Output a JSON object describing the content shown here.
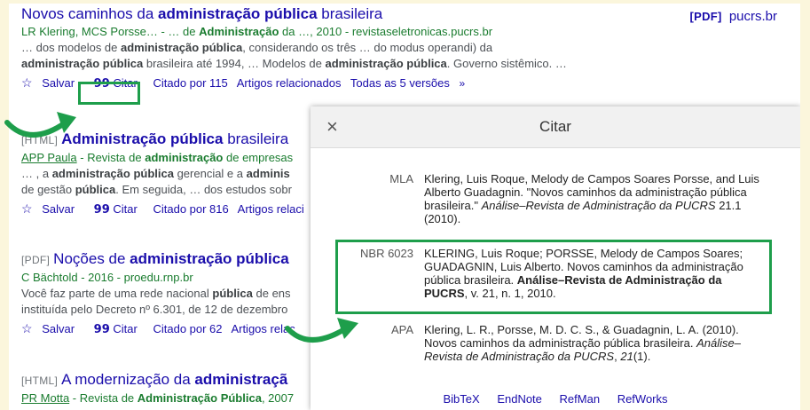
{
  "results": [
    {
      "title_plain_a": "Novos caminhos da ",
      "title_bold": "administração pública",
      "title_plain_b": " brasileira",
      "pdf_tag": "[PDF]",
      "pdf_site": "pucrs.br",
      "authors_a": "LR Klering, MCS Porsse… - … de ",
      "authors_bold": "Administração",
      "authors_b": " da …, 2010 - revistaseletronicas.pucrs.br",
      "snippet1_a": "… dos modelos de ",
      "snippet1_bold": "administração pública",
      "snippet1_b": ", considerando os três … do modus operandi) da",
      "snippet2_bold": "administração pública",
      "snippet2_a": " brasileira até 1994, … Modelos de ",
      "snippet2_bold2": "administração pública",
      "snippet2_b": ". Governo sistêmico. …",
      "save": "Salvar",
      "cite": "Citar",
      "cited_by": "Citado por 115",
      "related": "Artigos relacionados",
      "versions": "Todas as 5 versões"
    },
    {
      "tag": "[HTML]",
      "title_bold": "Administração pública",
      "title_plain": " brasileira",
      "authors_u": "APP Paula",
      "authors_a": " - Revista de ",
      "authors_bold": "administração",
      "authors_b": " de empresas",
      "snippet1_a": "… , a ",
      "snippet1_bold": "administração pública",
      "snippet1_b": " gerencial e a ",
      "snippet1_bold2": "adminis",
      "snippet2_a": "de gestão ",
      "snippet2_bold": "pública",
      "snippet2_b": ". Em seguida, … dos estudos sobr",
      "save": "Salvar",
      "cite": "Citar",
      "cited_by": "Citado por 816",
      "related": "Artigos relaci"
    },
    {
      "tag": "[PDF]",
      "title_plain": "Noções de ",
      "title_bold": "administração pública",
      "authors": "C Bächtold - 2016 - proedu.rnp.br",
      "snippet1_a": "Você faz parte de uma rede nacional ",
      "snippet1_bold": "pública",
      "snippet1_b": " de ens",
      "snippet2": "instituída pelo Decreto nº 6.301, de 12 de dezembro",
      "save": "Salvar",
      "cite": "Citar",
      "cited_by": "Citado por 62",
      "related": "Artigos relac"
    },
    {
      "tag": "[HTML]",
      "title_plain": "A modernização da ",
      "title_bold": "administraçã",
      "authors_u": "PR Motta",
      "authors_a": " - Revista de ",
      "authors_bold": "Administração Pública",
      "authors_b": ", 2007"
    }
  ],
  "dialog": {
    "title": "Citar",
    "close": "×",
    "mla_label": "MLA",
    "mla_a": "Klering, Luis Roque, Melody de Campos Soares Porsse, and Luis Alberto Guadagnin. \"Novos caminhos da administração pública brasileira.\" ",
    "mla_italic": "Análise–Revista de Administração da PUCRS",
    "mla_b": " 21.1 (2010).",
    "nbr_label": "NBR 6023",
    "nbr_a": "KLERING, Luis Roque; PORSSE, Melody de Campos Soares; GUADAGNIN, Luis Alberto. Novos caminhos da administração pública brasileira. ",
    "nbr_bold": "Análise–Revista de Administração da PUCRS",
    "nbr_b": ", v. 21, n. 1, 2010.",
    "apa_label": "APA",
    "apa_a": "Klering, L. R., Porsse, M. D. C. S., & Guadagnin, L. A. (2010). Novos caminhos da administração pública brasileira. ",
    "apa_italic": "Análise–Revista de Administração da PUCRS",
    "apa_b": ", ",
    "apa_italic2": "21",
    "apa_c": "(1).",
    "links": [
      "BibTeX",
      "EndNote",
      "RefMan",
      "RefWorks"
    ]
  },
  "colors": {
    "highlight": "#1e9e4b",
    "link": "#1a0dab",
    "source": "#1a7c2f"
  },
  "icons": [
    "star-icon",
    "quote-icon",
    "double-chevron-icon",
    "close-icon",
    "curved-arrow-icon"
  ]
}
